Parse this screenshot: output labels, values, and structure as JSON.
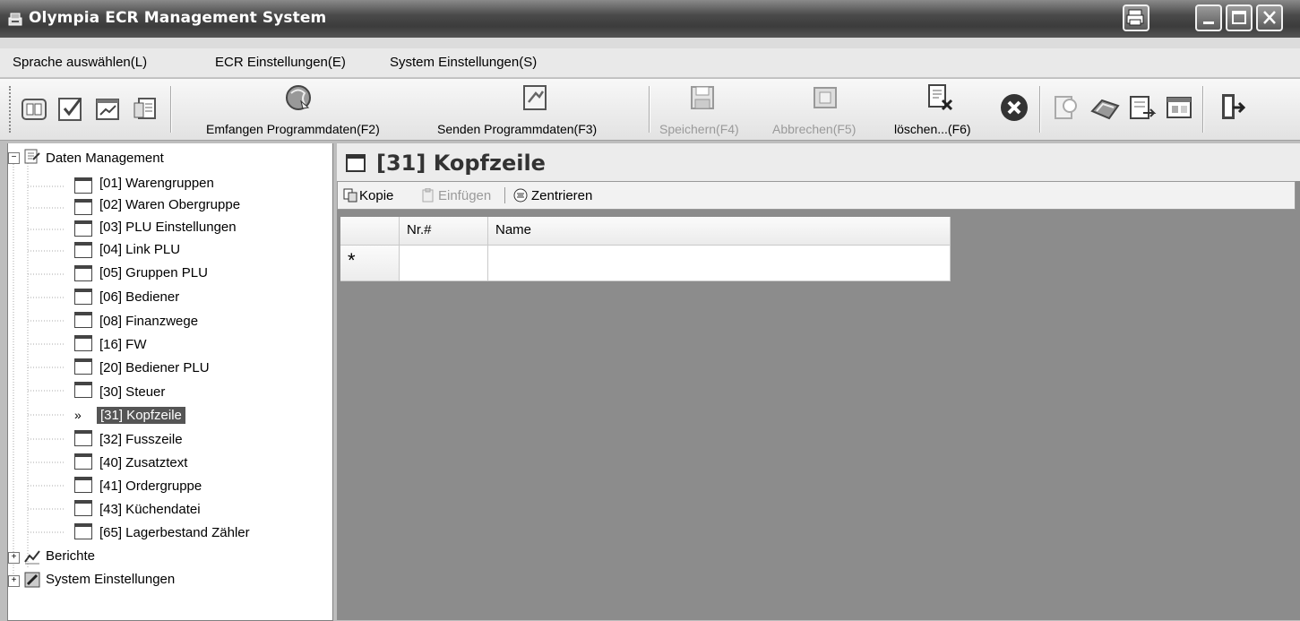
{
  "window": {
    "title": "Olympia ECR Management System"
  },
  "menubar": {
    "items": [
      "Sprache auswählen(L)",
      "ECR Einstellungen(E)",
      "System Einstellungen(S)"
    ]
  },
  "toolbar": {
    "receive_label": "Emfangen Programmdaten(F2)",
    "send_label": "Senden Programmdaten(F3)",
    "save_label": "Speichern(F4)",
    "cancel_label": "Abbrechen(F5)",
    "delete_label": "löschen...(F6)"
  },
  "tree": {
    "root": "Daten Management",
    "items": [
      "[01] Warengruppen",
      "[02] Waren Obergruppe",
      "[03] PLU Einstellungen",
      "[04] Link PLU",
      "[05] Gruppen PLU",
      "[06] Bediener",
      "[08] Finanzwege",
      "[16] FW",
      "[20] Bediener PLU",
      "[30] Steuer",
      "[31] Kopfzeile",
      "[32] Fusszeile",
      "[40] Zusatztext",
      "[41] Ordergruppe",
      "[43] Küchendatei",
      "[65] Lagerbestand Zähler"
    ],
    "selected_marker": "»",
    "berichte": "Berichte",
    "system": "System Einstellungen"
  },
  "content": {
    "title": "[31] Kopfzeile",
    "actions": {
      "copy": "Kopie",
      "insert": "Einfügen",
      "center": "Zentrieren"
    },
    "grid": {
      "columns": [
        "Nr.#",
        "Name"
      ],
      "new_row_marker": "*"
    }
  }
}
